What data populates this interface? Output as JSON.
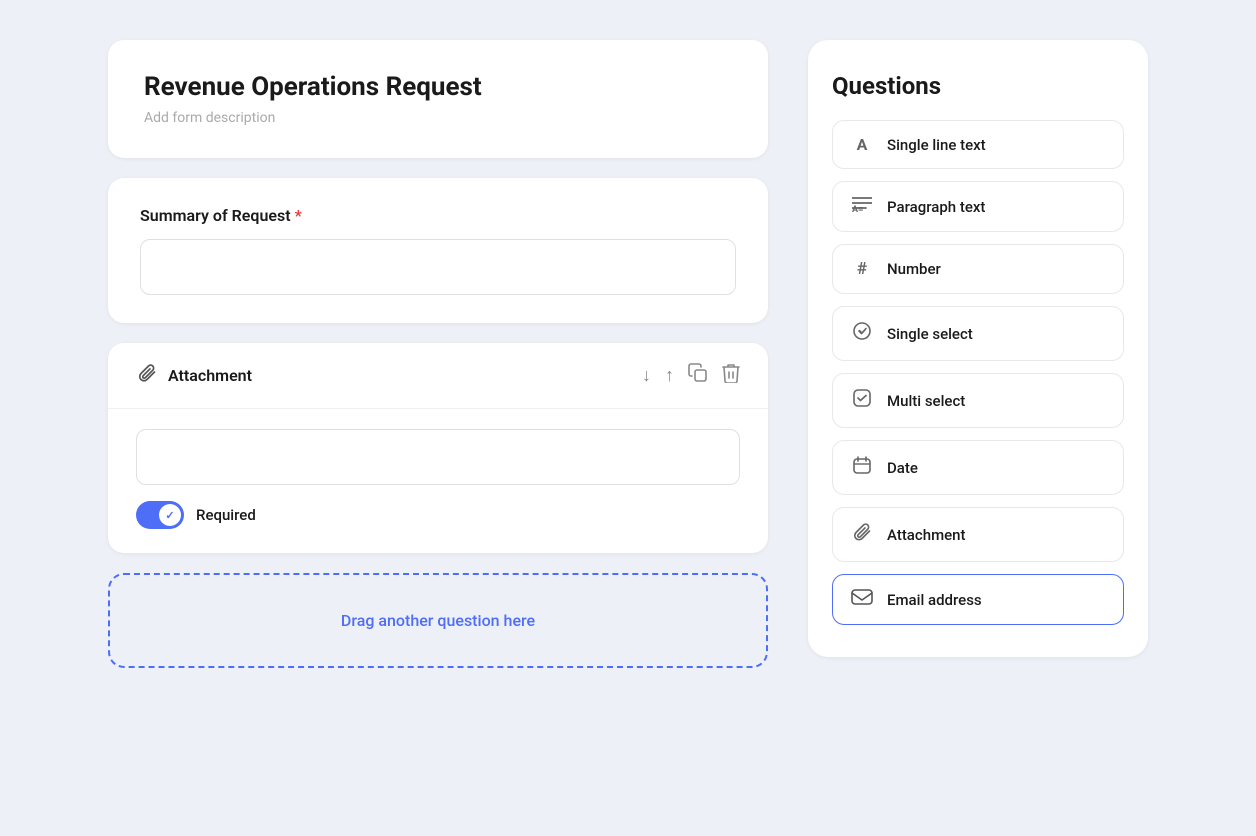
{
  "form": {
    "title": "Revenue Operations Request",
    "description_placeholder": "Add form description",
    "fields": [
      {
        "label": "Summary of Request",
        "required": true,
        "type": "text",
        "placeholder": ""
      },
      {
        "label": "Attachment",
        "type": "attachment",
        "required": true,
        "placeholder": ""
      }
    ],
    "drag_zone_text": "Drag another question here"
  },
  "questions_panel": {
    "title": "Questions",
    "items": [
      {
        "id": "single-line-text",
        "label": "Single line text",
        "icon": "A"
      },
      {
        "id": "paragraph-text",
        "label": "Paragraph text",
        "icon": "¶"
      },
      {
        "id": "number",
        "label": "Number",
        "icon": "#"
      },
      {
        "id": "single-select",
        "label": "Single select",
        "icon": "⊙"
      },
      {
        "id": "multi-select",
        "label": "Multi select",
        "icon": "☑"
      },
      {
        "id": "date",
        "label": "Date",
        "icon": "📅"
      },
      {
        "id": "attachment",
        "label": "Attachment",
        "icon": "🔗"
      },
      {
        "id": "email-address",
        "label": "Email address",
        "icon": "✉"
      }
    ]
  },
  "labels": {
    "required": "Required",
    "move_down": "↓",
    "move_up": "↑",
    "duplicate": "⊕",
    "delete": "🗑"
  },
  "colors": {
    "accent": "#4f6ef7",
    "required_star": "#e53935",
    "border": "#e0e0e0",
    "text_primary": "#1a1a1a",
    "text_muted": "#aaa",
    "drag_border": "#4f6ef7",
    "drag_text": "#4f6ef7"
  }
}
